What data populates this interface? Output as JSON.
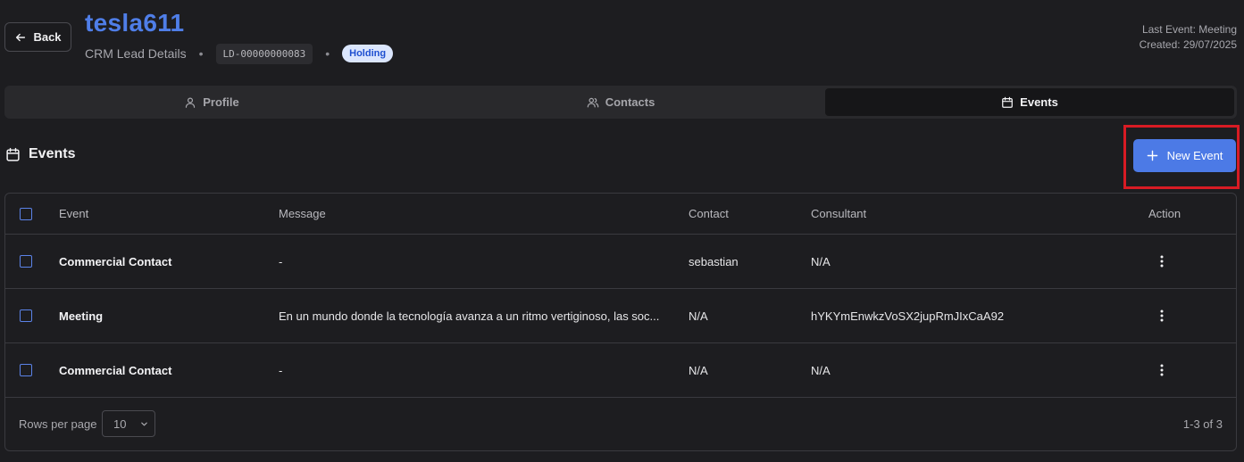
{
  "header": {
    "back_label": "Back",
    "title": "tesla611",
    "subtitle": "CRM Lead Details",
    "lead_id": "LD-00000000083",
    "status": "Holding",
    "last_event": "Last Event: Meeting",
    "created": "Created: 29/07/2025",
    "separator": "•"
  },
  "tabs": [
    {
      "label": "Profile",
      "icon": "user-icon",
      "active": false
    },
    {
      "label": "Contacts",
      "icon": "users-icon",
      "active": false
    },
    {
      "label": "Events",
      "icon": "calendar-icon",
      "active": true
    }
  ],
  "section": {
    "title": "Events",
    "new_event_label": "New Event"
  },
  "table": {
    "columns": [
      "Event",
      "Message",
      "Contact",
      "Consultant",
      "Action"
    ],
    "rows": [
      {
        "event": "Commercial Contact",
        "message": "-",
        "contact": "sebastian",
        "consultant": "N/A"
      },
      {
        "event": "Meeting",
        "message": "En un mundo donde la tecnología avanza a un ritmo vertiginoso, las soc...",
        "contact": "N/A",
        "consultant": "hYKYmEnwkzVoSX2jupRmJIxCaA92"
      },
      {
        "event": "Commercial Contact",
        "message": "-",
        "contact": "N/A",
        "consultant": "N/A"
      }
    ]
  },
  "pagination": {
    "rows_per_page_label": "Rows per page",
    "rows_per_page_value": "10",
    "range": "1-3 of 3"
  },
  "colors": {
    "accent": "#4c7ae6",
    "title": "#4f7ee8",
    "highlight": "#d81b24",
    "background": "#1d1d20"
  }
}
